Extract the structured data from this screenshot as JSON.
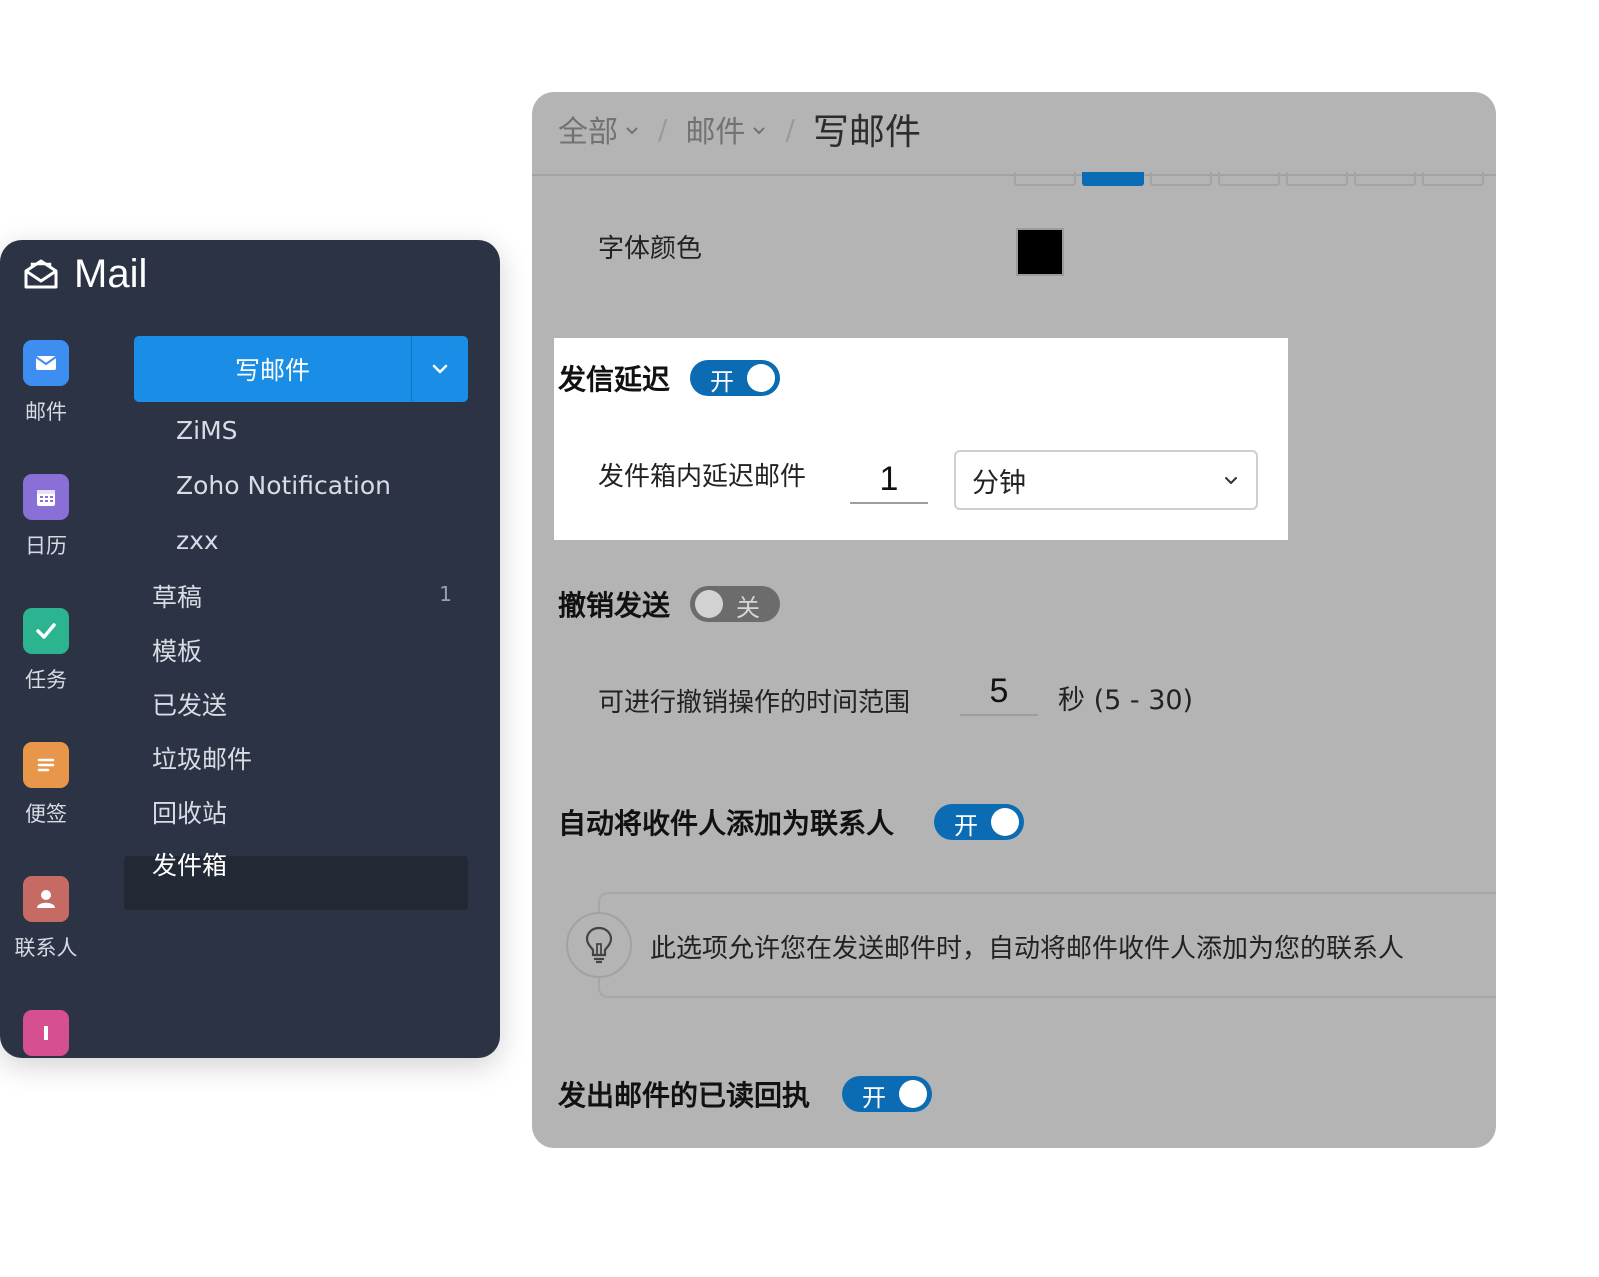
{
  "mail_panel": {
    "title": "Mail",
    "apps": [
      {
        "label": "邮件",
        "icon": "mail-icon",
        "color": "#3d8ef0"
      },
      {
        "label": "日历",
        "icon": "calendar-icon",
        "color": "#8a6fd6"
      },
      {
        "label": "任务",
        "icon": "check-icon",
        "color": "#2cb38f"
      },
      {
        "label": "便签",
        "icon": "notes-icon",
        "color": "#e8974a"
      },
      {
        "label": "联系人",
        "icon": "contact-icon",
        "color": "#c66b63"
      }
    ],
    "compose_label": "写邮件",
    "accounts": [
      "ZiMS",
      "Zoho Notification",
      "zxx"
    ],
    "folders": [
      {
        "label": "草稿",
        "count": "1"
      },
      {
        "label": "模板"
      },
      {
        "label": "已发送"
      },
      {
        "label": "垃圾邮件"
      },
      {
        "label": "回收站"
      },
      {
        "label": "发件箱"
      }
    ],
    "selected_folder": "发件箱"
  },
  "settings": {
    "breadcrumb": [
      "全部",
      "邮件"
    ],
    "breadcrumb_current": "写邮件",
    "font_color_label": "字体颜色",
    "font_color_value": "#000000",
    "send_delay": {
      "label": "发信延迟",
      "toggle_text": "开",
      "enabled": true,
      "delay_label": "发件箱内延迟邮件",
      "delay_value": "1",
      "delay_unit": "分钟"
    },
    "undo_send": {
      "label": "撤销发送",
      "toggle_text": "关",
      "enabled": false,
      "range_label": "可进行撤销操作的时间范围",
      "range_value": "5",
      "range_hint": "秒 (5 - 30)"
    },
    "auto_add_contacts": {
      "label": "自动将收件人添加为联系人",
      "toggle_text": "开",
      "enabled": true,
      "tip": "此选项允许您在发送邮件时，自动将邮件收件人添加为您的联系人"
    },
    "read_receipt": {
      "label": "发出邮件的已读回执",
      "toggle_text": "开",
      "enabled": true
    },
    "accent_color": "#0b6bb3"
  }
}
